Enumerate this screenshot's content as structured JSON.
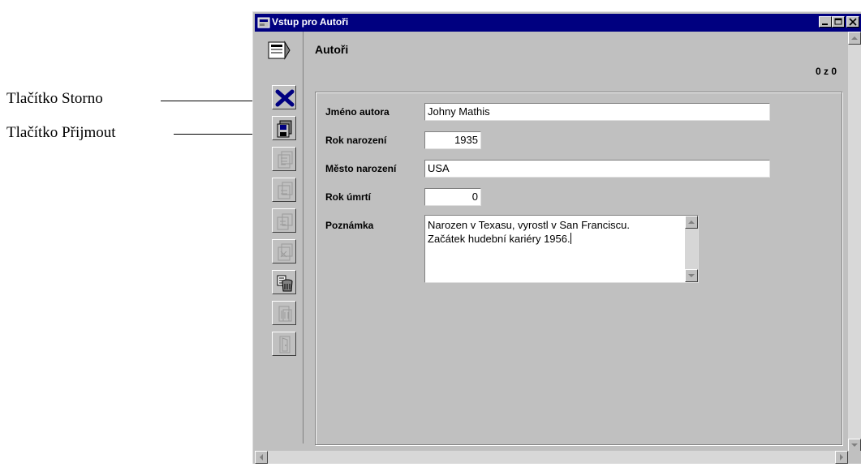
{
  "callouts": {
    "storno": "Tlačítko Storno",
    "prijmout": "Tlačítko Přijmout"
  },
  "window": {
    "title": "Vstup pro Autoři"
  },
  "header": {
    "title": "Autoři",
    "record_count": "0 z 0"
  },
  "form": {
    "name_label": "Jméno autora",
    "name_value": "Johny Mathis",
    "birth_year_label": "Rok narození",
    "birth_year_value": "1935",
    "birth_city_label": "Město narození",
    "birth_city_value": "USA",
    "death_year_label": "Rok úmrtí",
    "death_year_value": "0",
    "note_label": "Poznámka",
    "note_lines": [
      "Narozen v Texasu, vyrostl v San Franciscu.",
      "Začátek hudební kariéry 1956."
    ]
  },
  "toolbar": {
    "buttons": [
      {
        "icon": "cancel-x-icon",
        "enabled": true
      },
      {
        "icon": "save-disk-icon",
        "enabled": true
      },
      {
        "icon": "new-record-icon",
        "enabled": false
      },
      {
        "icon": "edit-record-icon",
        "enabled": false
      },
      {
        "icon": "copy-record-icon",
        "enabled": false
      },
      {
        "icon": "delete-record-icon",
        "enabled": false
      },
      {
        "icon": "trash-bin-icon",
        "enabled": true
      },
      {
        "icon": "print-icon",
        "enabled": false
      },
      {
        "icon": "exit-door-icon",
        "enabled": false
      }
    ]
  },
  "colors": {
    "title_bar": "#000080",
    "window_bg": "#c0c0c0",
    "cancel_x": "#000080"
  }
}
